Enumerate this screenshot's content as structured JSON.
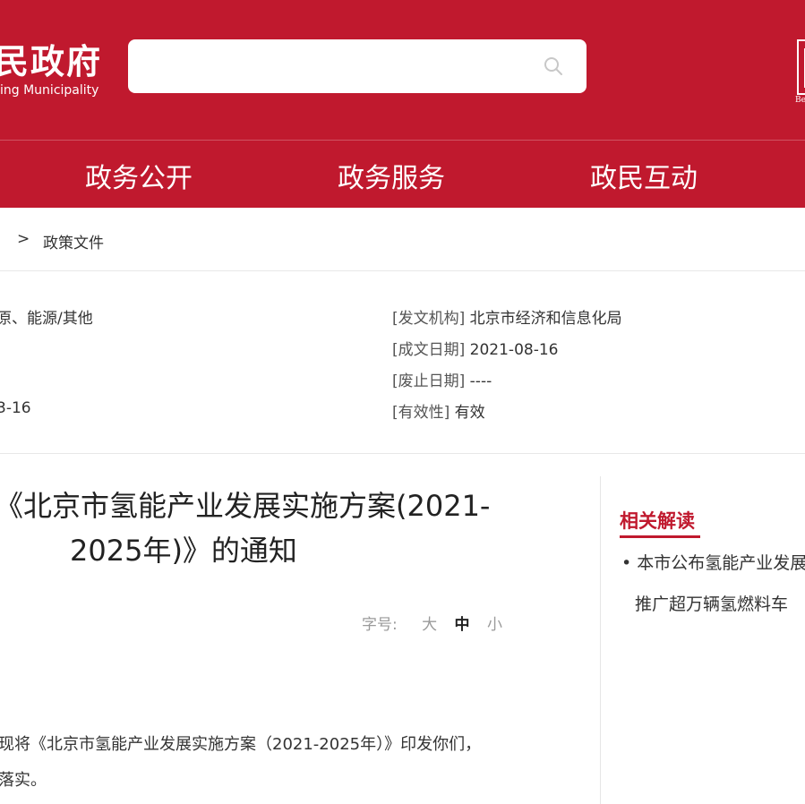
{
  "header": {
    "logo_cn": "民政府",
    "logo_en": "ing Municipality",
    "search": {
      "value": "",
      "placeholder": ""
    },
    "badge_text": "Be"
  },
  "nav": {
    "items": [
      {
        "label": "政务公开"
      },
      {
        "label": "政务服务"
      },
      {
        "label": "政民互动"
      }
    ]
  },
  "breadcrumb": {
    "separator": ">",
    "current": "政策文件"
  },
  "meta": {
    "left": [
      "原、能源/其他",
      "3-16"
    ],
    "right": [
      {
        "key": "[发文机构]",
        "value": "北京市经济和信息化局"
      },
      {
        "key": "[成文日期]",
        "value": "2021-08-16"
      },
      {
        "key": "[废止日期]",
        "value": "----"
      },
      {
        "key": "[有效性]",
        "value": "有效"
      }
    ]
  },
  "article": {
    "title_line1": "《北京市氢能产业发展实施方案(2021-",
    "title_line2": "2025年)》的通知",
    "font_size": {
      "label": "字号:",
      "large": "大",
      "medium": "中",
      "small": "小"
    },
    "body_line1": "现将《北京市氢能产业发展实施方案（2021-2025年）》印发你们，",
    "body_line2": "落实。"
  },
  "sidebar": {
    "title": "相关解读",
    "items": [
      {
        "bullet": "•",
        "label": "本市公布氢能产业发展"
      },
      {
        "label": "推广超万辆氢燃料车"
      }
    ]
  },
  "colors": {
    "brand": "#c0192e"
  }
}
